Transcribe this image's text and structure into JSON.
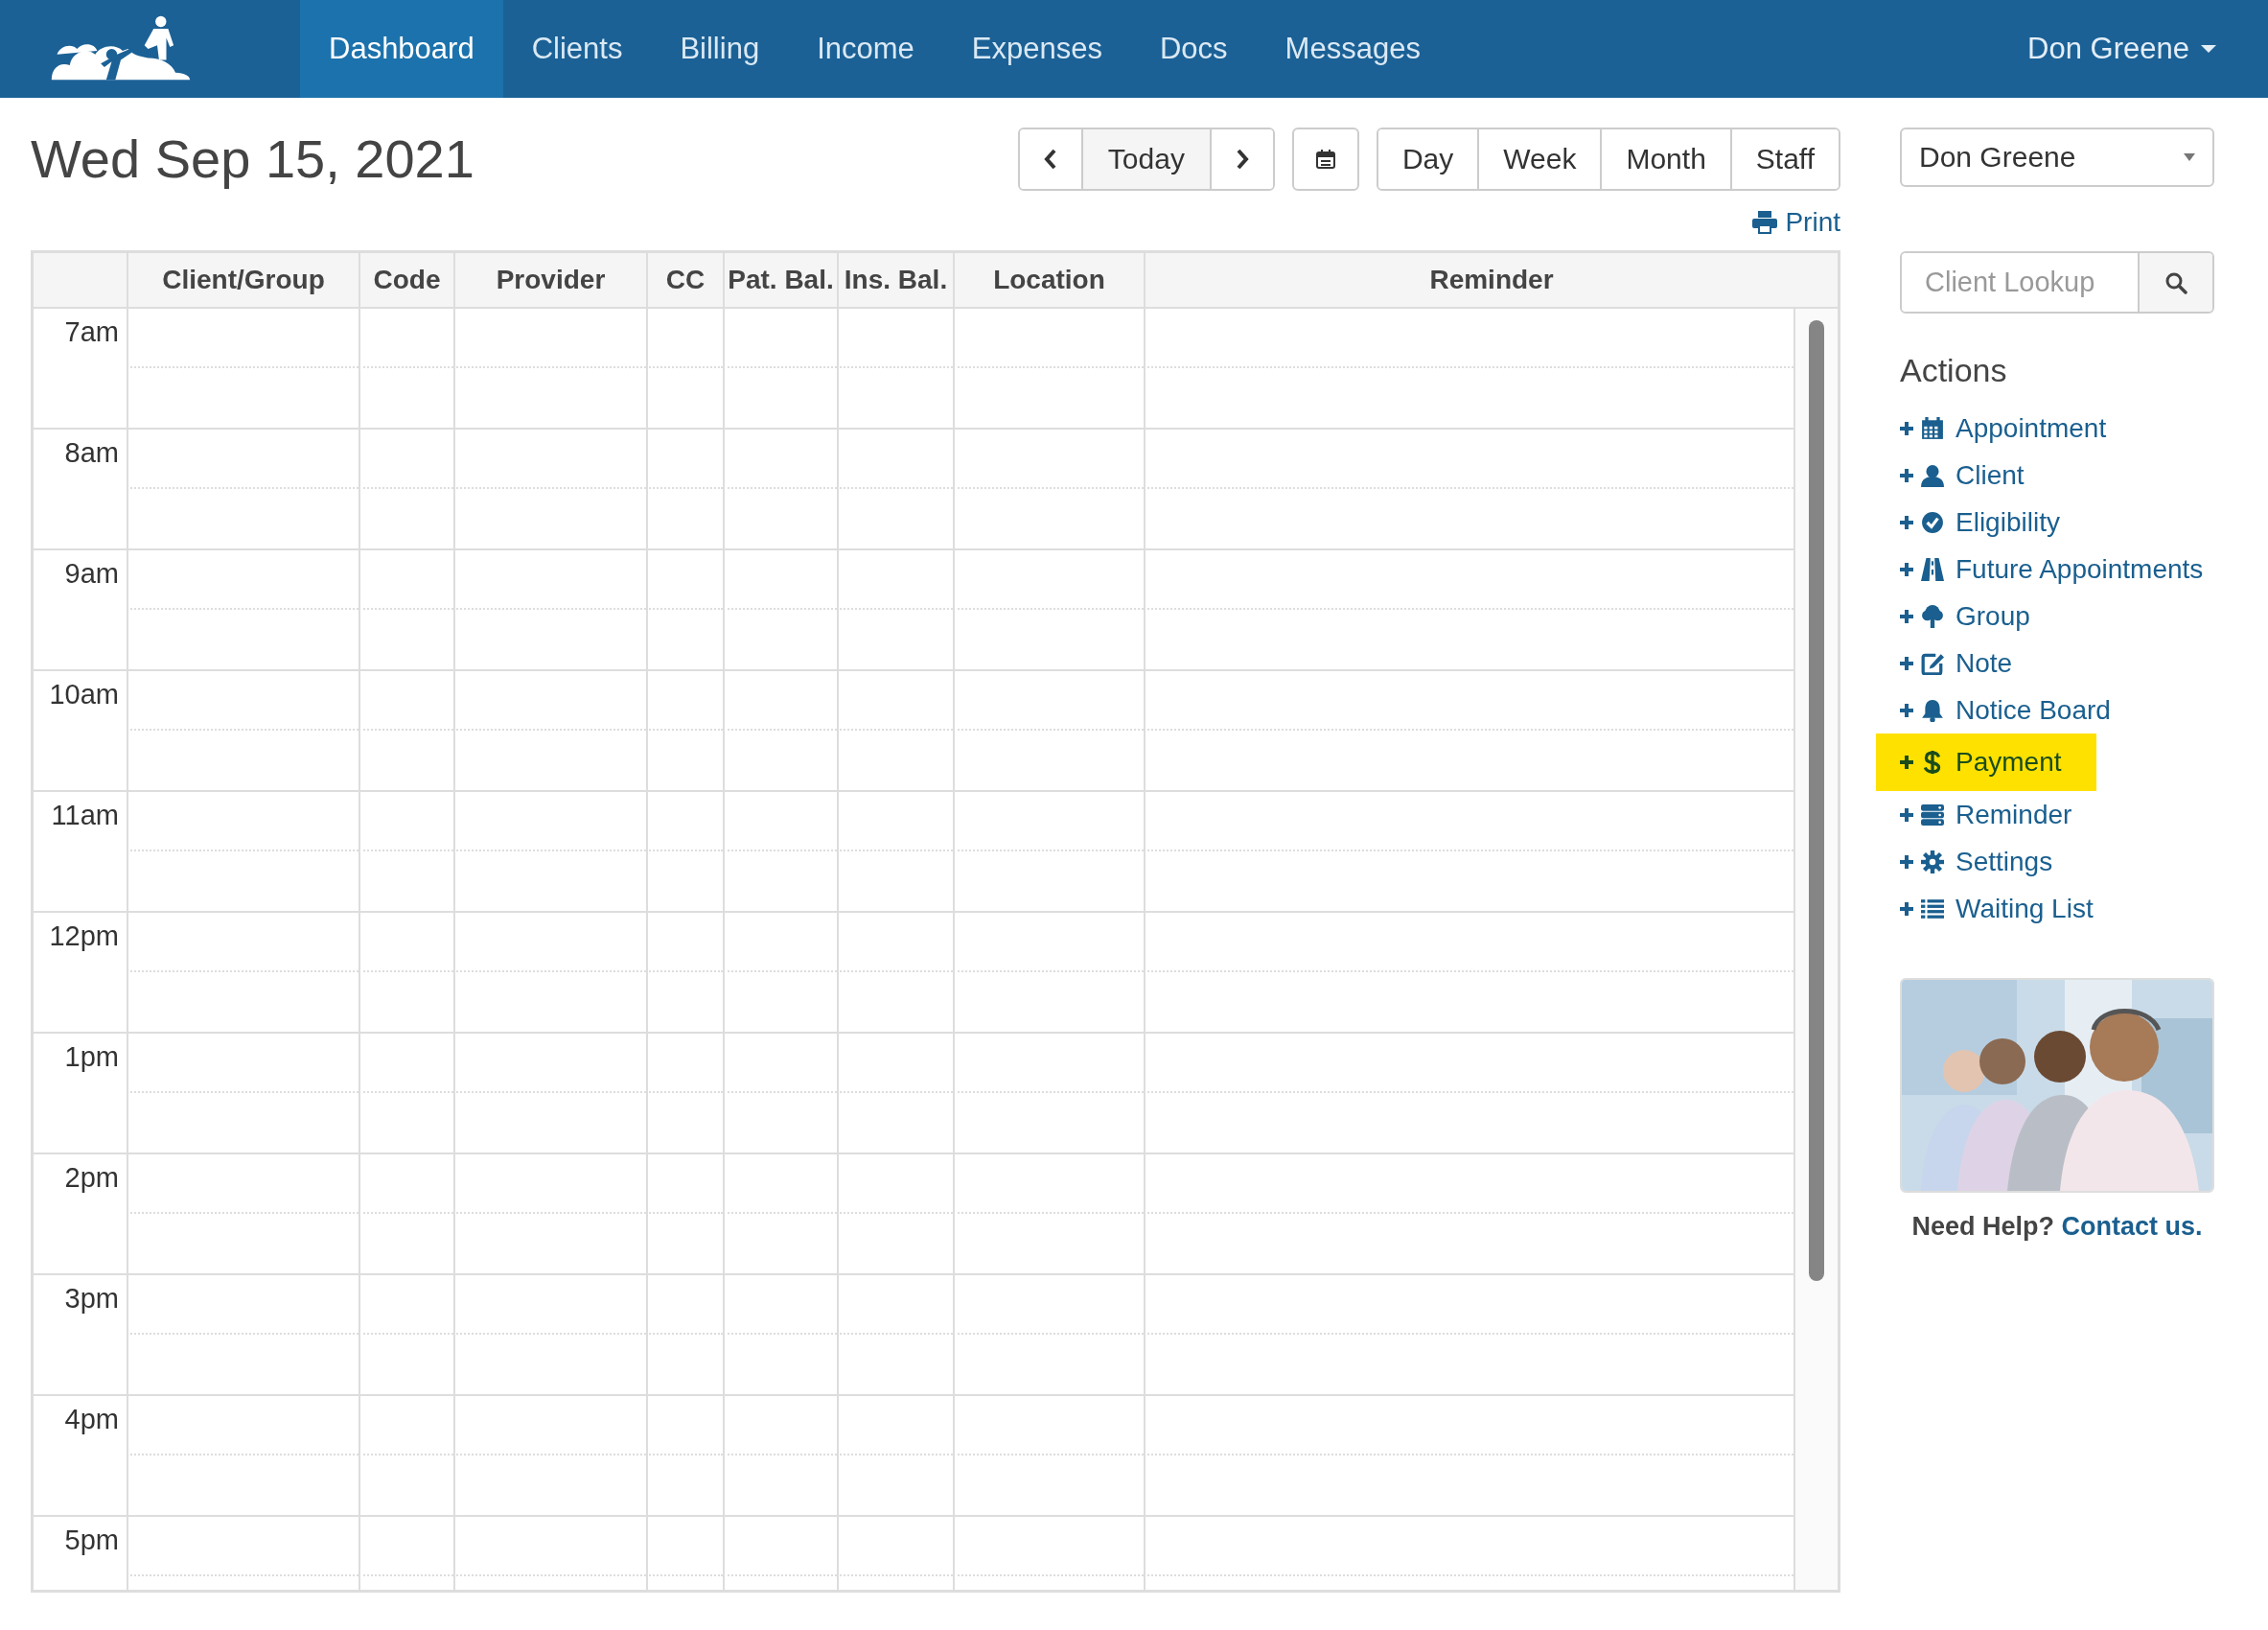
{
  "nav": {
    "items": [
      {
        "label": "Dashboard",
        "selected": true
      },
      {
        "label": "Clients",
        "selected": false
      },
      {
        "label": "Billing",
        "selected": false
      },
      {
        "label": "Income",
        "selected": false
      },
      {
        "label": "Expenses",
        "selected": false
      },
      {
        "label": "Docs",
        "selected": false
      },
      {
        "label": "Messages",
        "selected": false
      }
    ],
    "user": "Don Greene"
  },
  "date_title": "Wed Sep 15, 2021",
  "today_button": "Today",
  "views": [
    {
      "label": "Day",
      "selected": false
    },
    {
      "label": "Week",
      "selected": false
    },
    {
      "label": "Month",
      "selected": false
    },
    {
      "label": "Staff",
      "selected": false
    }
  ],
  "print_link": "Print",
  "table": {
    "columns": [
      "Client/Group",
      "Code",
      "Provider",
      "CC",
      "Pat. Bal.",
      "Ins. Bal.",
      "Location",
      "Reminder"
    ],
    "rows": [
      {
        "time": "7am"
      },
      {
        "time": "8am"
      },
      {
        "time": "9am"
      },
      {
        "time": "10am"
      },
      {
        "time": "11am"
      },
      {
        "time": "12pm"
      },
      {
        "time": "1pm"
      },
      {
        "time": "2pm"
      },
      {
        "time": "3pm"
      },
      {
        "time": "4pm"
      },
      {
        "time": "5pm"
      }
    ]
  },
  "provider_select": {
    "value": "Don Greene"
  },
  "client_lookup": {
    "placeholder": "Client Lookup"
  },
  "actions": {
    "title": "Actions",
    "items": [
      {
        "label": "Appointment",
        "kind": "calendar",
        "highlighted": false
      },
      {
        "label": "Client",
        "kind": "user",
        "highlighted": false
      },
      {
        "label": "Eligibility",
        "kind": "check",
        "highlighted": false
      },
      {
        "label": "Future Appointments",
        "kind": "road",
        "highlighted": false
      },
      {
        "label": "Group",
        "kind": "tree",
        "highlighted": false
      },
      {
        "label": "Note",
        "kind": "edit",
        "highlighted": false
      },
      {
        "label": "Notice Board",
        "kind": "bell",
        "highlighted": false
      },
      {
        "label": "Payment",
        "kind": "dollar",
        "highlighted": true
      },
      {
        "label": "Reminder",
        "kind": "server",
        "highlighted": false
      },
      {
        "label": "Settings",
        "kind": "gear",
        "highlighted": false
      },
      {
        "label": "Waiting List",
        "kind": "list",
        "highlighted": false
      }
    ]
  },
  "help": {
    "kind": "picture",
    "text": "Need Help?",
    "link": "Contact us."
  }
}
